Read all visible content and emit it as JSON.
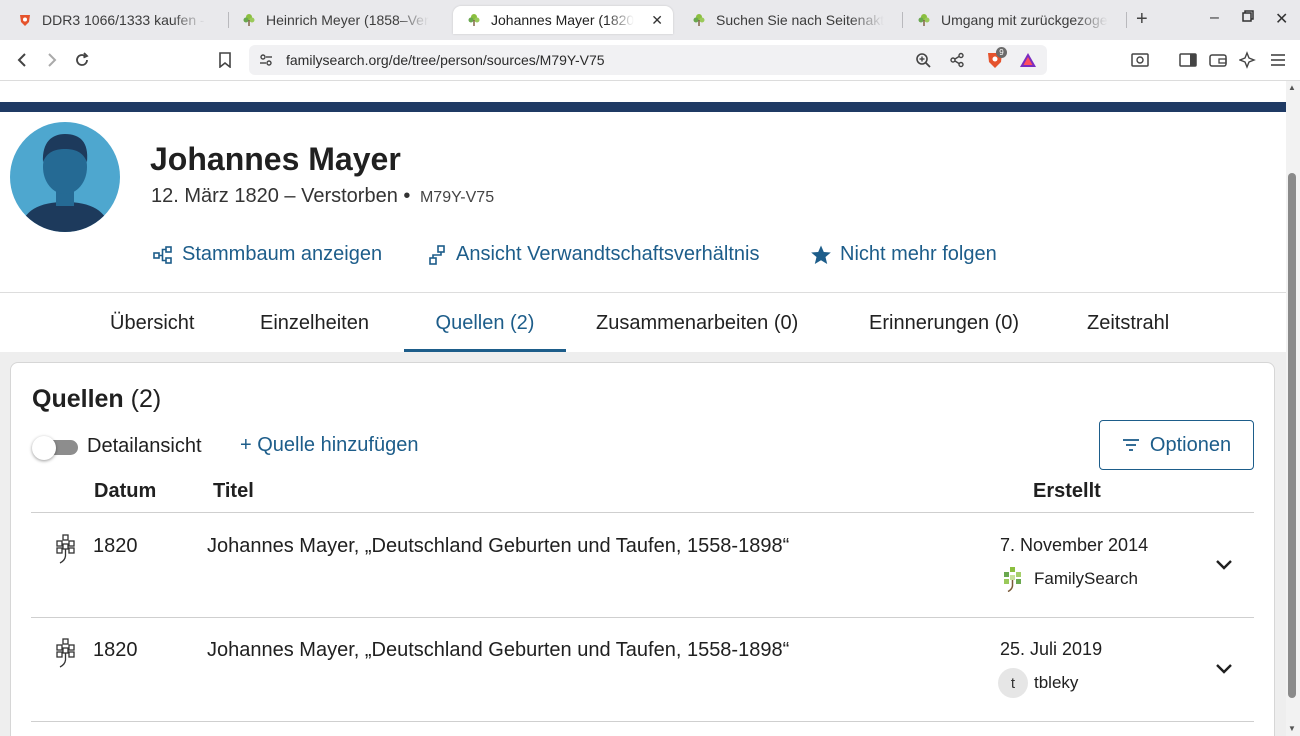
{
  "browser": {
    "tabs": [
      {
        "title": "DDR3 1066/1333 kaufen -",
        "icon": "brave-lion-icon"
      },
      {
        "title": "Heinrich Meyer (1858–Ver",
        "icon": "familysearch-tree-icon"
      },
      {
        "title": "Johannes Mayer (1820",
        "icon": "familysearch-tree-icon",
        "active": true
      },
      {
        "title": "Suchen Sie nach Seitenakt",
        "icon": "familysearch-tree-icon"
      },
      {
        "title": "Umgang mit zurückgezoge",
        "icon": "familysearch-tree-icon"
      }
    ],
    "url": "familysearch.org/de/tree/person/sources/M79Y-V75",
    "shield_count": "9"
  },
  "person": {
    "name": "Johannes Mayer",
    "lifespan": "12. März 1820 – Verstorben",
    "separator": "•",
    "pid": "M79Y-V75",
    "actions": [
      {
        "label": "Stammbaum anzeigen",
        "icon": "tree-view-icon"
      },
      {
        "label": "Ansicht Verwandtschaftsverhältnis",
        "icon": "relationship-icon"
      },
      {
        "label": "Nicht mehr folgen",
        "icon": "star-icon"
      }
    ]
  },
  "person_tabs": [
    {
      "label": "Übersicht"
    },
    {
      "label": "Einzelheiten"
    },
    {
      "label": "Quellen (2)",
      "active": true
    },
    {
      "label": "Zusammenarbeiten (0)"
    },
    {
      "label": "Erinnerungen (0)"
    },
    {
      "label": "Zeitstrahl"
    }
  ],
  "sources": {
    "heading": "Quellen",
    "count": "(2)",
    "toggle_label": "Detailansicht",
    "toggle_on": false,
    "add_label": "+ Quelle hinzufügen",
    "options_label": "Optionen",
    "columns": {
      "date": "Datum",
      "title": "Titel",
      "created": "Erstellt"
    },
    "rows": [
      {
        "year": "1820",
        "title": "Johannes Mayer, „Deutschland Geburten und Taufen, 1558-1898“",
        "created_date": "7. November 2014",
        "created_by": "FamilySearch",
        "by_icon": "familysearch-tree-icon"
      },
      {
        "year": "1820",
        "title": "Johannes Mayer, „Deutschland Geburten und Taufen, 1558-1898“",
        "created_date": "25. Juli 2019",
        "created_by": "tbleky",
        "by_initial": "t"
      }
    ]
  },
  "colors": {
    "accent": "#1d5d8a",
    "header_stripe": "#1f3a64",
    "avatar_bg": "#4ea7cf"
  }
}
